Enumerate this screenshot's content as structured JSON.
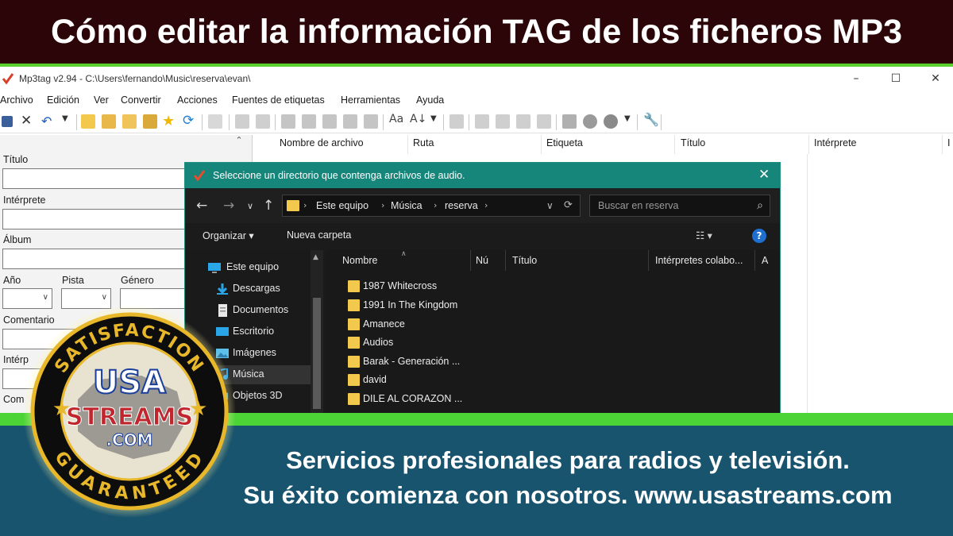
{
  "banner": {
    "title": "Cómo editar la información TAG de los ficheros MP3"
  },
  "app": {
    "title": "Mp3tag v2.94  -  C:\\Users\\fernando\\Music\\reserva\\evan\\",
    "window_controls": [
      "–",
      "☐",
      "✕"
    ],
    "menu": [
      "Archivo",
      "Edición",
      "Ver",
      "Convertir",
      "Acciones",
      "Fuentes de etiquetas",
      "Herramientas",
      "Ayuda"
    ],
    "tag_panel": {
      "labels": {
        "title": "Título",
        "artist": "Intérprete",
        "album": "Álbum",
        "year": "Año",
        "track": "Pista",
        "genre": "Género",
        "comment": "Comentario",
        "artist2": "Intérp",
        "composer": "Com"
      }
    },
    "columns": [
      "Nombre de archivo",
      "Ruta",
      "Etiqueta",
      "Título",
      "Intérprete",
      "I"
    ]
  },
  "dialog": {
    "title": "Seleccione un directorio que contenga archivos de audio.",
    "breadcrumb": [
      "Este equipo",
      "Música",
      "reserva"
    ],
    "search_placeholder": "Buscar en reserva",
    "commands": {
      "organize": "Organizar ▾",
      "new_folder": "Nueva carpeta",
      "help": "?"
    },
    "nav_items": [
      {
        "label": "Este equipo",
        "icon": "computer-icon"
      },
      {
        "label": "Descargas",
        "icon": "download-icon"
      },
      {
        "label": "Documentos",
        "icon": "document-icon"
      },
      {
        "label": "Escritorio",
        "icon": "desktop-icon"
      },
      {
        "label": "Imágenes",
        "icon": "pictures-icon"
      },
      {
        "label": "Música",
        "icon": "music-icon"
      },
      {
        "label": "Objetos 3D",
        "icon": "3d-objects-icon"
      }
    ],
    "columns": [
      "Nombre",
      "Nú",
      "Título",
      "Intérpretes colabo...",
      "A"
    ],
    "folders": [
      "1987 Whitecross",
      "1991 In The Kingdom",
      "Amanece",
      "Audios",
      "Barak - Generación ...",
      "david",
      "DILE AL CORAZON ..."
    ]
  },
  "bottom": {
    "line1": "Servicios profesionales para radios y televisión.",
    "line2": "Su éxito comienza con nosotros. www.usastreams.com"
  },
  "logo": {
    "top_text": "SATISFACTION",
    "main1": "USA",
    "main2": "STREAMS",
    "main3": ".COM",
    "bottom_text": "GUARANTEED"
  },
  "colors": {
    "banner_bg": "#2b0508",
    "accent_green": "#4cd437",
    "bottom_bg": "#19546e",
    "dialog_titlebar": "#16857a",
    "logo_gold": "#e8b82a"
  }
}
